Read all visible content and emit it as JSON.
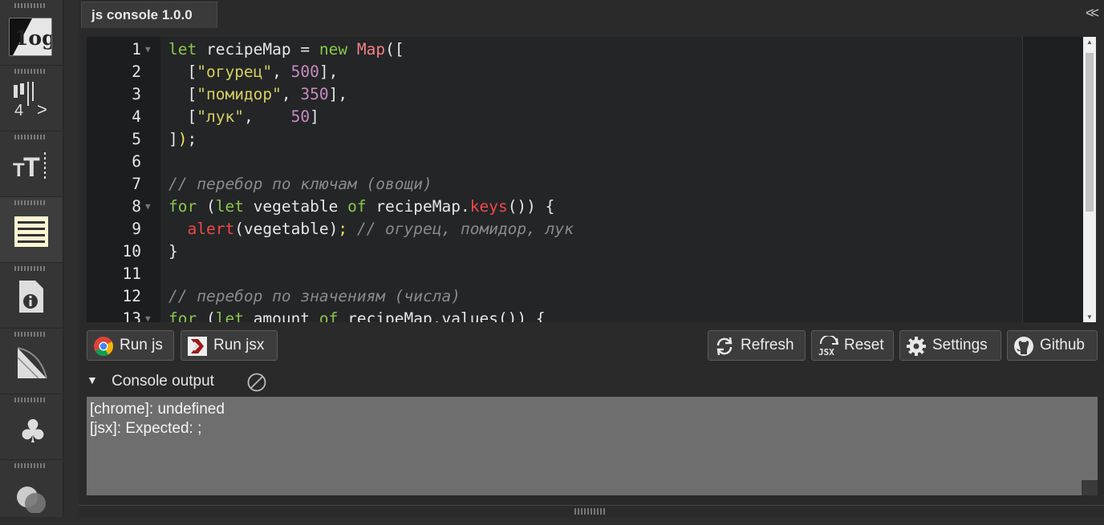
{
  "sidebar": {
    "items": [
      {
        "name": "log-icon",
        "glyph": "log"
      },
      {
        "name": "indent-guides-icon",
        "glyph": "4>"
      },
      {
        "name": "text-size-icon",
        "glyph": "tT"
      },
      {
        "name": "wrap-lines-icon",
        "glyph": "≡"
      },
      {
        "name": "file-info-icon",
        "glyph": "i"
      },
      {
        "name": "fold-icon",
        "glyph": "◢"
      },
      {
        "name": "club-icon",
        "glyph": "♣"
      },
      {
        "name": "theme-circles-icon",
        "glyph": "◍"
      }
    ]
  },
  "tab": {
    "title": "js console 1.0.0"
  },
  "collapse_label": "<<",
  "editor": {
    "line_numbers": [
      "1",
      "2",
      "3",
      "4",
      "5",
      "6",
      "7",
      "8",
      "9",
      "10",
      "11",
      "12",
      "13"
    ]
  },
  "buttons": {
    "run_js": "Run js",
    "run_jsx": "Run jsx",
    "refresh": "Refresh",
    "reset": "Reset",
    "settings": "Settings",
    "github": "Github"
  },
  "console": {
    "title": "Console output",
    "toggle": "▼",
    "lines": [
      "[chrome]: undefined",
      "[jsx]: Expected: ;"
    ]
  },
  "colors": {
    "keyword": "#8ac64b",
    "function": "#f08080",
    "string": "#d8cf5e",
    "number": "#c98ac0",
    "comment": "#8a8a8a"
  }
}
